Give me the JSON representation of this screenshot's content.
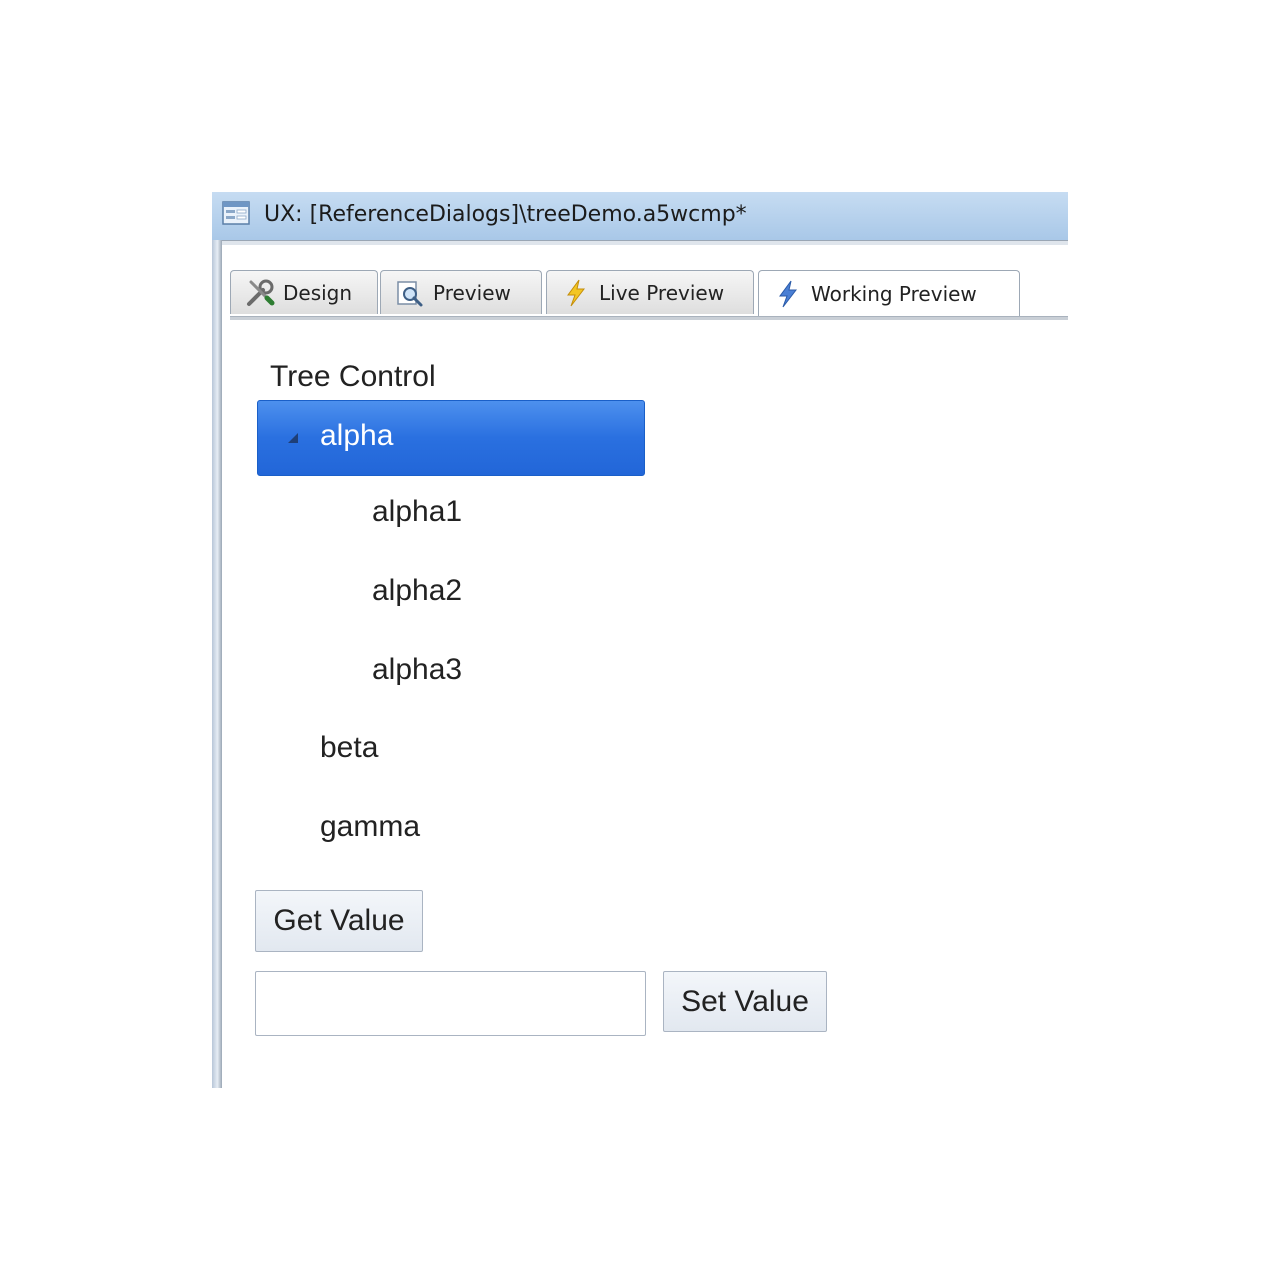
{
  "window": {
    "title": "UX: [ReferenceDialogs]\\treeDemo.a5wcmp*"
  },
  "tabs": [
    {
      "label": "Design",
      "icon": "wrench-screwdriver-icon",
      "active": false
    },
    {
      "label": "Preview",
      "icon": "magnifier-page-icon",
      "active": false
    },
    {
      "label": "Live Preview",
      "icon": "lightning-icon",
      "active": false
    },
    {
      "label": "Working Preview",
      "icon": "lightning-icon",
      "active": true
    }
  ],
  "tree": {
    "label": "Tree Control",
    "selected": "alpha",
    "nodes": [
      {
        "label": "alpha",
        "expanded": true,
        "children": [
          "alpha1",
          "alpha2",
          "alpha3"
        ]
      },
      {
        "label": "beta"
      },
      {
        "label": "gamma"
      }
    ]
  },
  "controls": {
    "get_value_label": "Get Value",
    "set_value_label": "Set Value",
    "value_input": ""
  },
  "colors": {
    "selection": "#2a70e0",
    "titlebar": "#b8d2ee"
  }
}
